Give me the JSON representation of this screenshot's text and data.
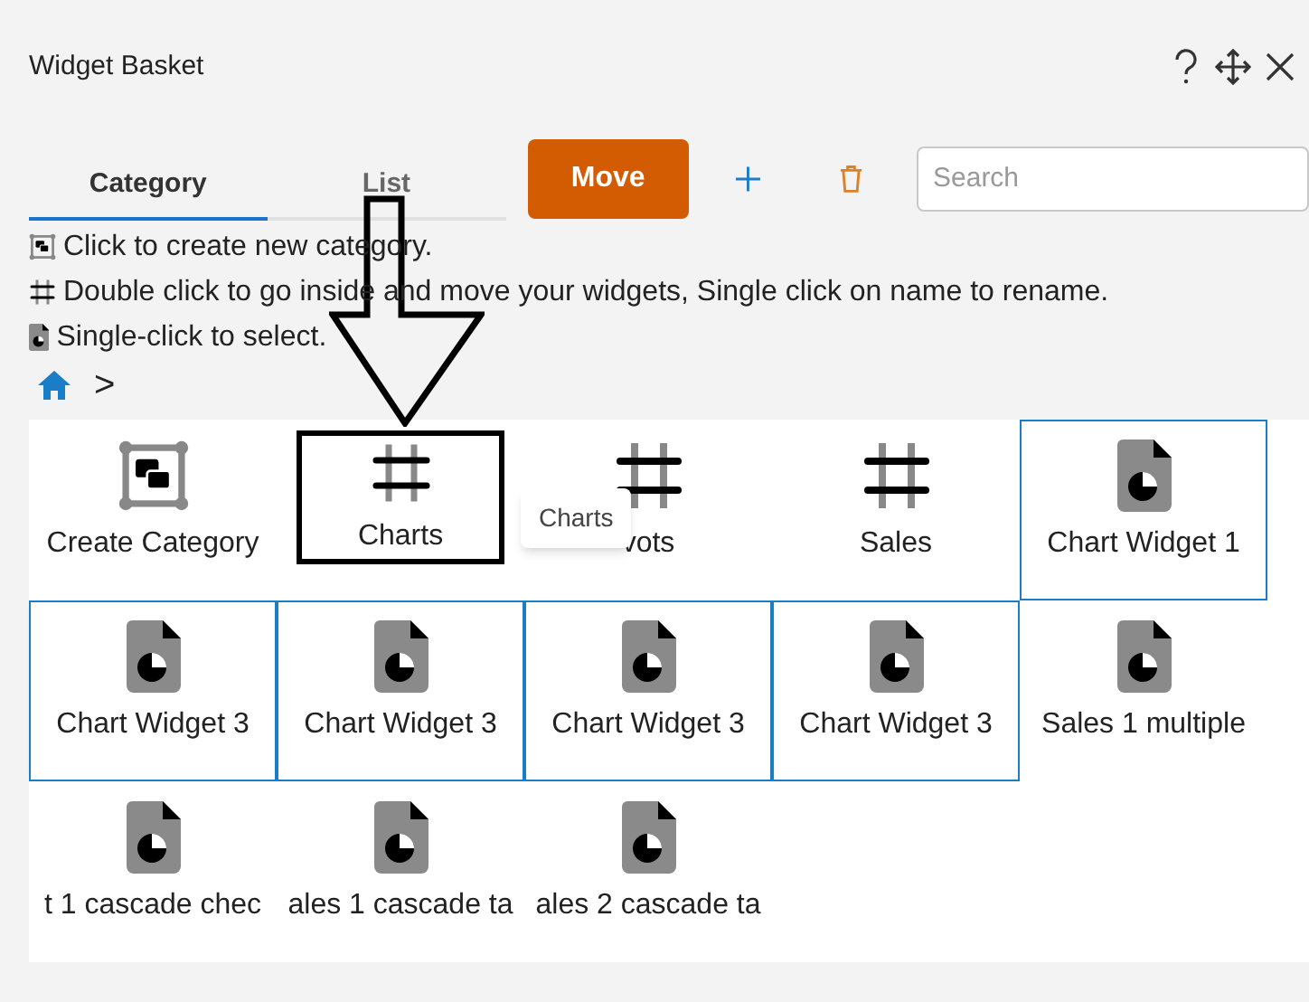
{
  "window": {
    "title": "Widget Basket"
  },
  "tabs": [
    {
      "label": "Category",
      "selected": true
    },
    {
      "label": "List",
      "selected": false
    }
  ],
  "toolbar": {
    "move_button": "Move",
    "search": {
      "placeholder": "Search"
    }
  },
  "hints": [
    {
      "kind": "create",
      "text": "Click to create new category."
    },
    {
      "kind": "category",
      "text": "Double click to go inside and move your widgets, Single click on name to rename."
    },
    {
      "kind": "widget",
      "text": "Single-click to select."
    }
  ],
  "breadcrumb": {
    "separator": ">"
  },
  "tiles": [
    {
      "kind": "create",
      "label": "Create Category",
      "selected": false,
      "focused": false
    },
    {
      "kind": "category",
      "label": "Charts",
      "selected": false,
      "focused": true
    },
    {
      "kind": "category",
      "label": "vots",
      "selected": false,
      "focused": false
    },
    {
      "kind": "category",
      "label": "Sales",
      "selected": false,
      "focused": false
    },
    {
      "kind": "widget",
      "label": "Chart Widget 1",
      "selected": true,
      "focused": false
    },
    {
      "kind": "widget",
      "label": "Chart Widget 3",
      "selected": true,
      "focused": false
    },
    {
      "kind": "widget",
      "label": "Chart Widget 3",
      "selected": true,
      "focused": false
    },
    {
      "kind": "widget",
      "label": "Chart Widget 3",
      "selected": true,
      "focused": false
    },
    {
      "kind": "widget",
      "label": "Chart Widget 3",
      "selected": true,
      "focused": false
    },
    {
      "kind": "widget",
      "label": "Sales 1 multiple",
      "selected": false,
      "focused": false
    },
    {
      "kind": "widget",
      "label": "t 1 cascade chec",
      "selected": false,
      "focused": false
    },
    {
      "kind": "widget",
      "label": "ales 1 cascade ta",
      "selected": false,
      "focused": false
    },
    {
      "kind": "widget",
      "label": "ales 2 cascade ta",
      "selected": false,
      "focused": false
    }
  ],
  "tooltip": {
    "text": "Charts"
  }
}
